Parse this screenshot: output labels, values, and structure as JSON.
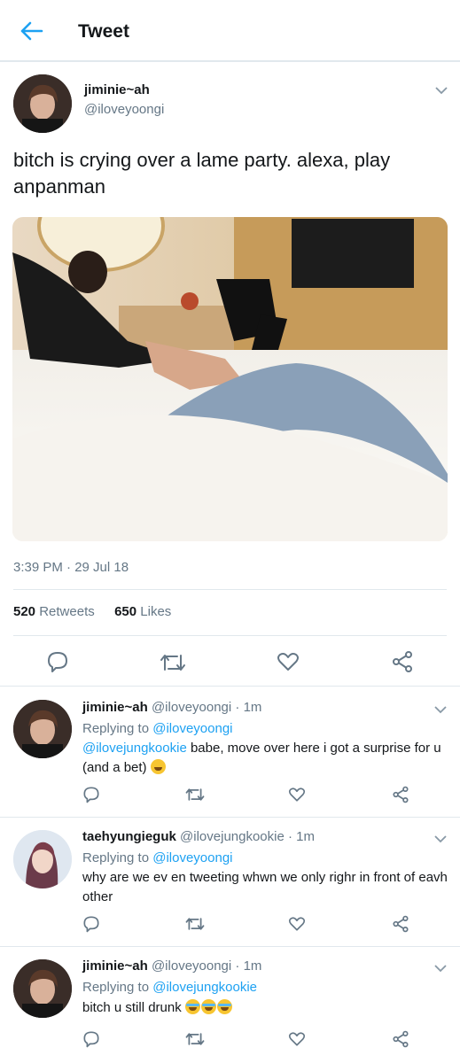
{
  "topbar": {
    "title": "Tweet"
  },
  "main_tweet": {
    "name": "jiminie~ah",
    "handle": "@iloveyoongi",
    "text": "bitch is crying over a lame party. alexa, play anpanman",
    "timestamp": "3:39 PM · 29 Jul 18",
    "retweets_count": "520",
    "retweets_label": "Retweets",
    "likes_count": "650",
    "likes_label": "Likes"
  },
  "replies": [
    {
      "name": "jiminie~ah",
      "handle": "@iloveyoongi",
      "time": "· 1m",
      "replying_label": "Replying to",
      "replying_to": "@iloveyoongi",
      "mention": "@ilovejungkookie",
      "text": " babe, move over here i got a surprise for u (and a bet)",
      "emoji": "smiling-face"
    },
    {
      "name": "taehyungieguk",
      "handle": "@ilovejungkookie",
      "time": "· 1m",
      "replying_label": "Replying to",
      "replying_to": "@iloveyoongi",
      "text": "why are we ev en tweeting whwn we only righr in front of eavh other"
    },
    {
      "name": "jiminie~ah",
      "handle": "@iloveyoongi",
      "time": "· 1m",
      "replying_label": "Replying to",
      "replying_to": "@ilovejungkookie",
      "text": "bitch u still drunk",
      "emoji": "tears-of-joy x3"
    }
  ],
  "colors": {
    "accent": "#1da1f2",
    "muted": "#657786",
    "divider": "#e1e8ed",
    "text": "#14171a"
  }
}
